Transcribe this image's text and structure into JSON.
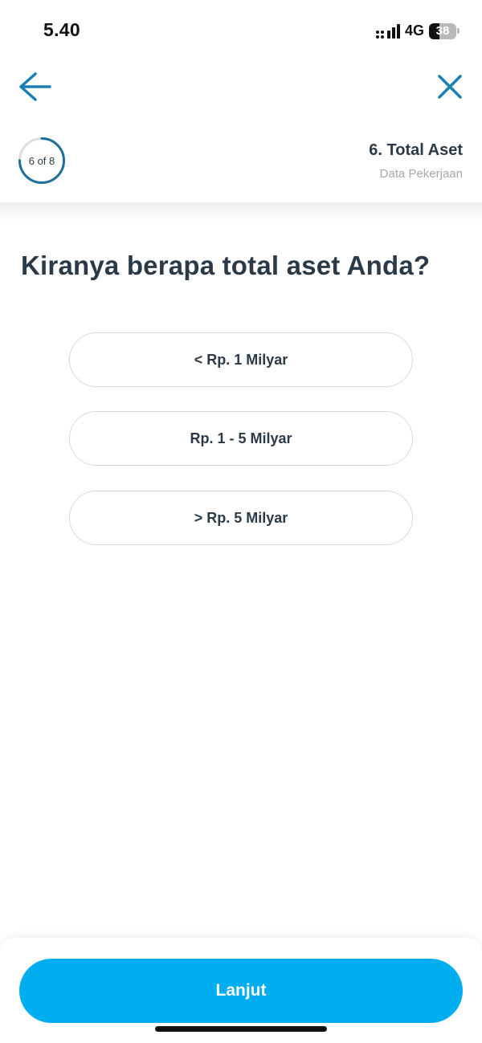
{
  "status_bar": {
    "time": "5.40",
    "network": "4G",
    "battery": "38",
    "battery_level_percent": 38
  },
  "nav": {
    "back_icon": "arrow-left-icon",
    "close_icon": "close-icon",
    "accent_color": "#1a7fb3"
  },
  "step": {
    "current": 6,
    "total": 8,
    "label": "6 of 8",
    "title": "6. Total Aset",
    "subtitle": "Data Pekerjaan",
    "ring_color": "#1f6f9a",
    "ring_track_color": "#dddddd"
  },
  "question": "Kiranya berapa total aset Anda?",
  "options": [
    {
      "label": "< Rp. 1 Milyar"
    },
    {
      "label": "Rp. 1 - 5 Milyar"
    },
    {
      "label": "> Rp. 5 Milyar"
    }
  ],
  "footer": {
    "continue_label": "Lanjut",
    "button_color": "#00aeef"
  }
}
